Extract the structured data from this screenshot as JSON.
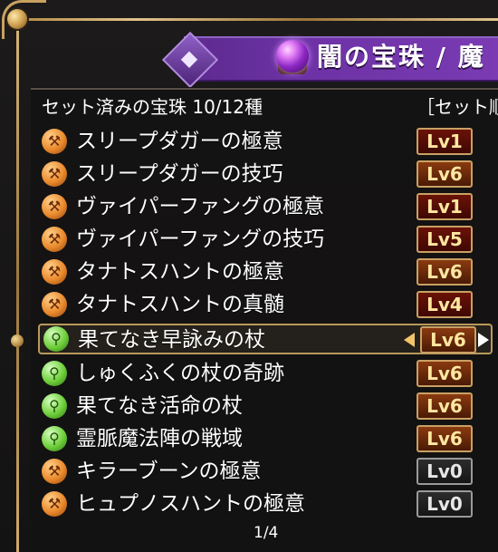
{
  "window": {
    "title": "闇の宝珠 / 魔"
  },
  "header": {
    "left_label": "セット済みの宝珠 10/12種",
    "right_label": "［セット順"
  },
  "list": [
    {
      "name": "スリープダガーの極意",
      "level": "Lv1",
      "gem": "orange"
    },
    {
      "name": "スリープダガーの技巧",
      "level": "Lv6",
      "gem": "orange"
    },
    {
      "name": "ヴァイパーファングの極意",
      "level": "Lv1",
      "gem": "orange"
    },
    {
      "name": "ヴァイパーファングの技巧",
      "level": "Lv5",
      "gem": "orange"
    },
    {
      "name": "タナトスハントの極意",
      "level": "Lv6",
      "gem": "orange"
    },
    {
      "name": "タナトスハントの真髄",
      "level": "Lv4",
      "gem": "orange"
    },
    {
      "name": "果てなき早詠みの杖",
      "level": "Lv6",
      "gem": "green",
      "selected": true
    },
    {
      "name": "しゅくふくの杖の奇跡",
      "level": "Lv6",
      "gem": "green"
    },
    {
      "name": "果てなき活命の杖",
      "level": "Lv6",
      "gem": "green"
    },
    {
      "name": "霊脈魔法陣の戦域",
      "level": "Lv6",
      "gem": "green"
    },
    {
      "name": "キラーブーンの極意",
      "level": "Lv0",
      "gem": "orange"
    },
    {
      "name": "ヒュプノスハントの極意",
      "level": "Lv0",
      "gem": "orange"
    }
  ],
  "pagination": {
    "label": "1/4"
  },
  "colors": {
    "banner": "#6d32a5",
    "gold": "#c9a063",
    "panel": "#141313"
  }
}
